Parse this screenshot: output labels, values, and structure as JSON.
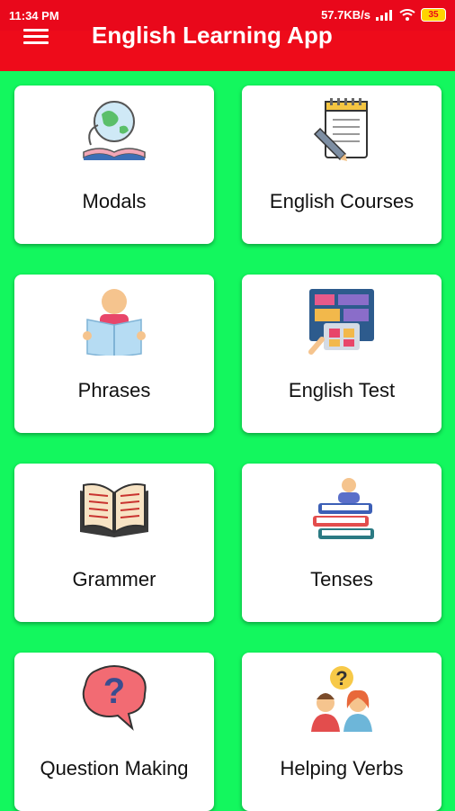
{
  "status_bar": {
    "time": "11:34 PM",
    "network_speed": "57.7KB/s",
    "battery_level": "35"
  },
  "app_bar": {
    "menu_icon": "hamburger-menu-icon",
    "title": "English Learning App"
  },
  "colors": {
    "app_bar": "#ee0b1a",
    "background": "#13f75e",
    "card": "#ffffff"
  },
  "tiles": [
    {
      "label": "Modals",
      "icon": "globe-book-icon"
    },
    {
      "label": "English Courses",
      "icon": "notepad-pencil-icon"
    },
    {
      "label": "Phrases",
      "icon": "person-reading-icon"
    },
    {
      "label": "English Test",
      "icon": "test-board-icon"
    },
    {
      "label": "Grammer",
      "icon": "open-book-icon"
    },
    {
      "label": "Tenses",
      "icon": "books-person-icon"
    },
    {
      "label": "Question Making",
      "icon": "question-bubble-icon"
    },
    {
      "label": "Helping Verbs",
      "icon": "people-question-icon"
    }
  ]
}
